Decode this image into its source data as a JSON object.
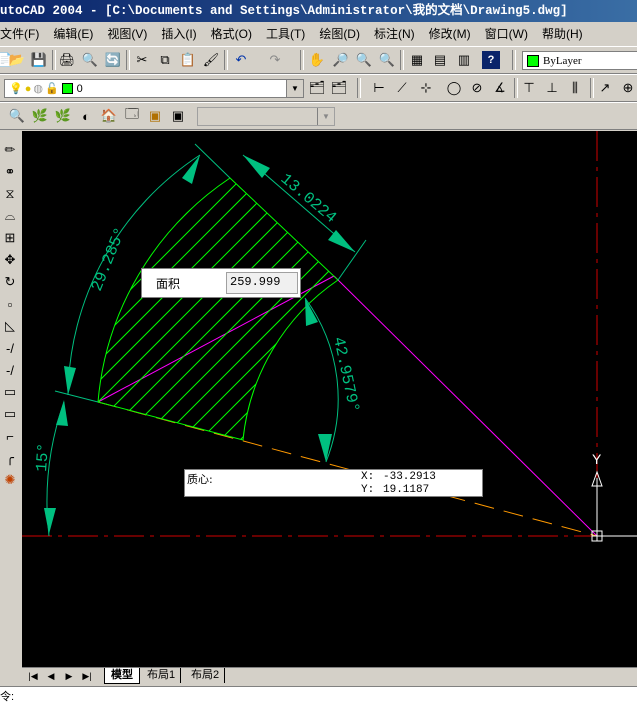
{
  "window": {
    "title": "utoCAD 2004 - [C:\\Documents and Settings\\Administrator\\我的文档\\Drawing5.dwg]"
  },
  "menu": [
    "文件(F)",
    "编辑(E)",
    "视图(V)",
    "插入(I)",
    "格式(O)",
    "工具(T)",
    "绘图(D)",
    "标注(N)",
    "修改(M)",
    "窗口(W)",
    "帮助(H)"
  ],
  "toolbar": {
    "color_combo": "ByLayer",
    "layer_combo": "0"
  },
  "dimensions": {
    "linear": "13.0224",
    "angle_top": "29.285°",
    "angle_right": "42.9579°",
    "angle_bottom": "15°"
  },
  "area_tip": {
    "label": "面积",
    "value": "259.999"
  },
  "centroid_tip": {
    "label": "质心:",
    "x_label": "X:",
    "x_value": "-33.2913",
    "y_label": "Y:",
    "y_value": "19.1187"
  },
  "ucs": {
    "y_axis": "Y"
  },
  "tabs": [
    "模型",
    "布局1",
    "布局2"
  ],
  "command": {
    "prompt": "令:"
  },
  "colors": {
    "canvas": "#000000",
    "hatch": "#00ff00",
    "dimension": "#00c080",
    "magenta": "#ff00ff",
    "red_axis": "#d00000",
    "orange": "#ff9900"
  }
}
